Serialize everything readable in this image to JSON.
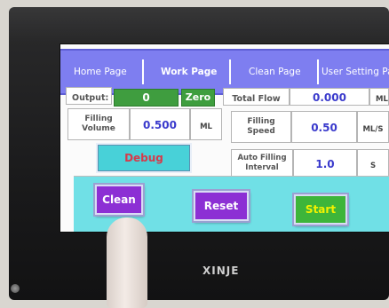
{
  "device": {
    "brand": "XINJE"
  },
  "tabs": [
    {
      "label": "Home Page",
      "active": false
    },
    {
      "label": "Work Page",
      "active": true
    },
    {
      "label": "Clean Page",
      "active": false
    },
    {
      "label": "User Setting Pa",
      "active": false
    }
  ],
  "output": {
    "label": "Output:",
    "value": "0",
    "zero_button": "Zero"
  },
  "total_flow": {
    "label": "Total Flow",
    "value": "0.000",
    "unit": "ML"
  },
  "filling_volume": {
    "label": "Filling Volume",
    "value": "0.500",
    "unit": "ML"
  },
  "filling_speed": {
    "label": "Filling Speed",
    "value": "0.50",
    "unit": "ML/S"
  },
  "debug_button": "Debug",
  "auto_interval": {
    "label": "Auto Filling Interval",
    "value": "1.0",
    "unit": "S"
  },
  "buttons": {
    "clean": "Clean",
    "reset": "Reset",
    "start": "Start"
  },
  "colors": {
    "tab_bar": "#7e7ef0",
    "value_text": "#3a3acc",
    "zero_green": "#3e9e3e",
    "debug_bg": "#48d1d8",
    "debug_text": "#d63a4a",
    "panel_bg": "#70e0e6",
    "clean_btn": "#8c2fd4",
    "reset_btn": "#8c2fd4",
    "start_btn": "#3db53a"
  }
}
